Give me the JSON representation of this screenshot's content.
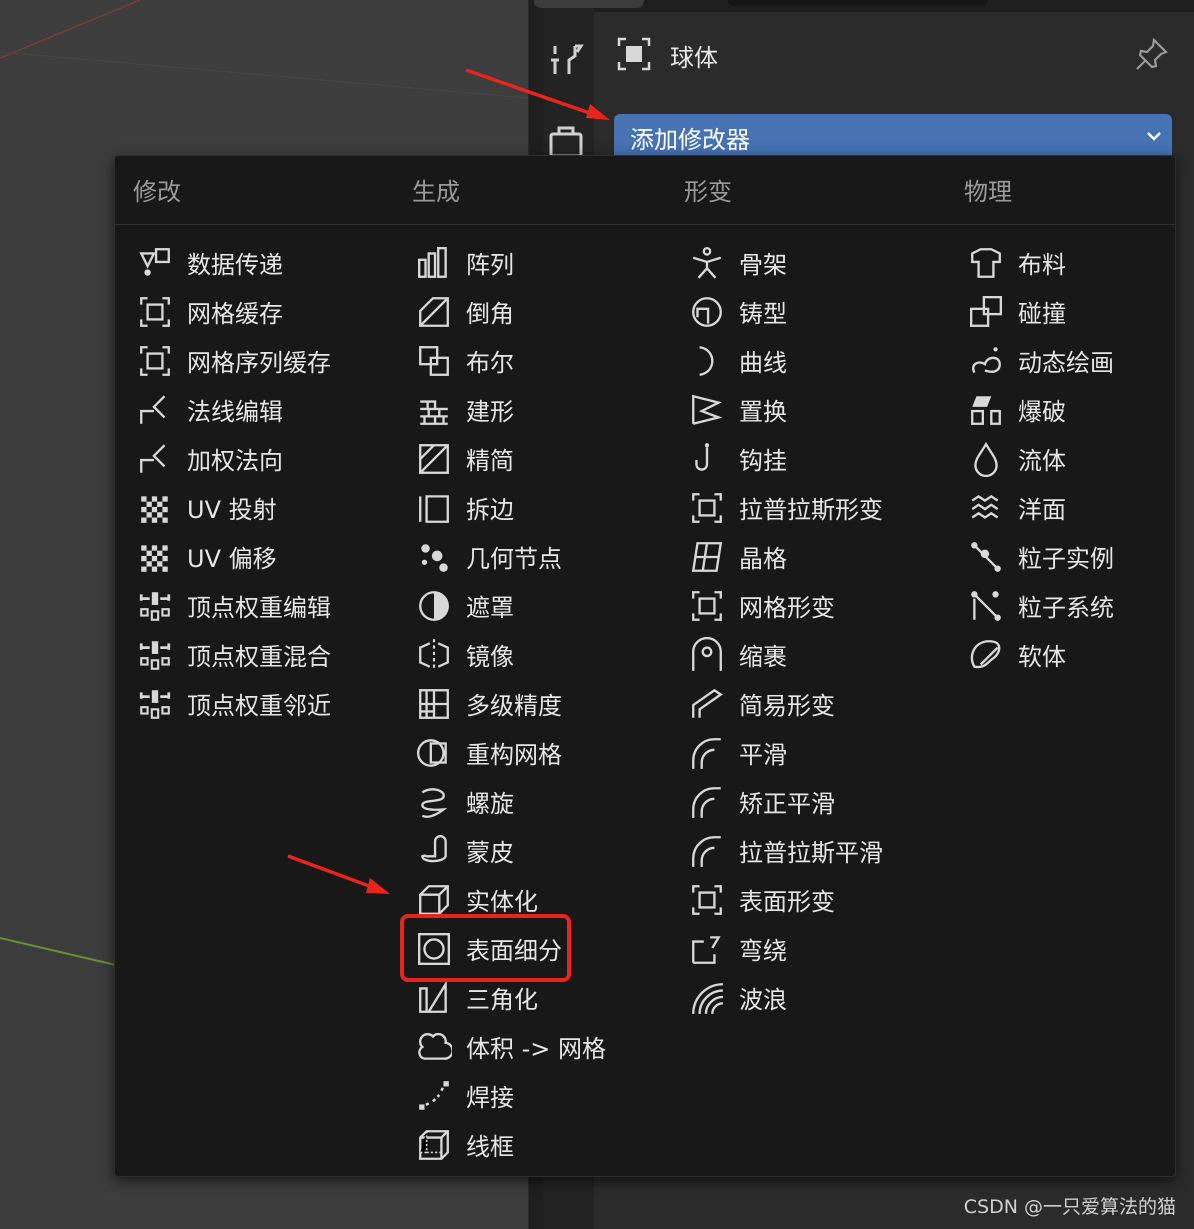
{
  "object": {
    "name": "球体",
    "icon": "mesh-object-icon"
  },
  "add_modifier": {
    "label": "添加修改器",
    "icon": "chevron-down-icon"
  },
  "categories": [
    "修改",
    "生成",
    "形变",
    "物理"
  ],
  "columns": [
    {
      "category": "修改",
      "items": [
        {
          "label": "数据传递",
          "icon": "data-transfer-icon"
        },
        {
          "label": "网格缓存",
          "icon": "mesh-cache-icon"
        },
        {
          "label": "网格序列缓存",
          "icon": "mesh-sequence-cache-icon"
        },
        {
          "label": "法线编辑",
          "icon": "normal-edit-icon"
        },
        {
          "label": "加权法向",
          "icon": "weighted-normal-icon"
        },
        {
          "label": "UV 投射",
          "icon": "uv-project-icon"
        },
        {
          "label": "UV 偏移",
          "icon": "uv-warp-icon"
        },
        {
          "label": "顶点权重编辑",
          "icon": "vertex-weight-edit-icon"
        },
        {
          "label": "顶点权重混合",
          "icon": "vertex-weight-mix-icon"
        },
        {
          "label": "顶点权重邻近",
          "icon": "vertex-weight-proximity-icon"
        }
      ]
    },
    {
      "category": "生成",
      "items": [
        {
          "label": "阵列",
          "icon": "array-icon"
        },
        {
          "label": "倒角",
          "icon": "bevel-icon"
        },
        {
          "label": "布尔",
          "icon": "boolean-icon"
        },
        {
          "label": "建形",
          "icon": "build-icon"
        },
        {
          "label": "精简",
          "icon": "decimate-icon"
        },
        {
          "label": "拆边",
          "icon": "edge-split-icon"
        },
        {
          "label": "几何节点",
          "icon": "geometry-nodes-icon"
        },
        {
          "label": "遮罩",
          "icon": "mask-icon"
        },
        {
          "label": "镜像",
          "icon": "mirror-icon"
        },
        {
          "label": "多级精度",
          "icon": "multires-icon"
        },
        {
          "label": "重构网格",
          "icon": "remesh-icon"
        },
        {
          "label": "螺旋",
          "icon": "screw-icon"
        },
        {
          "label": "蒙皮",
          "icon": "skin-icon"
        },
        {
          "label": "实体化",
          "icon": "solidify-icon"
        },
        {
          "label": "表面细分",
          "icon": "subdivision-surface-icon"
        },
        {
          "label": "三角化",
          "icon": "triangulate-icon"
        },
        {
          "label": "体积 -> 网格",
          "icon": "volume-to-mesh-icon"
        },
        {
          "label": "焊接",
          "icon": "weld-icon"
        },
        {
          "label": "线框",
          "icon": "wireframe-icon"
        }
      ]
    },
    {
      "category": "形变",
      "items": [
        {
          "label": "骨架",
          "icon": "armature-icon"
        },
        {
          "label": "铸型",
          "icon": "cast-icon"
        },
        {
          "label": "曲线",
          "icon": "curve-icon"
        },
        {
          "label": "置换",
          "icon": "displace-icon"
        },
        {
          "label": "钩挂",
          "icon": "hook-icon"
        },
        {
          "label": "拉普拉斯形变",
          "icon": "laplacian-deform-icon"
        },
        {
          "label": "晶格",
          "icon": "lattice-icon"
        },
        {
          "label": "网格形变",
          "icon": "mesh-deform-icon"
        },
        {
          "label": "缩裹",
          "icon": "shrinkwrap-icon"
        },
        {
          "label": "简易形变",
          "icon": "simple-deform-icon"
        },
        {
          "label": "平滑",
          "icon": "smooth-icon"
        },
        {
          "label": "矫正平滑",
          "icon": "corrective-smooth-icon"
        },
        {
          "label": "拉普拉斯平滑",
          "icon": "laplacian-smooth-icon"
        },
        {
          "label": "表面形变",
          "icon": "surface-deform-icon"
        },
        {
          "label": "弯绕",
          "icon": "warp-icon"
        },
        {
          "label": "波浪",
          "icon": "wave-icon"
        }
      ]
    },
    {
      "category": "物理",
      "items": [
        {
          "label": "布料",
          "icon": "cloth-icon"
        },
        {
          "label": "碰撞",
          "icon": "collision-icon"
        },
        {
          "label": "动态绘画",
          "icon": "dynamic-paint-icon"
        },
        {
          "label": "爆破",
          "icon": "explode-icon"
        },
        {
          "label": "流体",
          "icon": "fluid-icon"
        },
        {
          "label": "洋面",
          "icon": "ocean-icon"
        },
        {
          "label": "粒子实例",
          "icon": "particle-instance-icon"
        },
        {
          "label": "粒子系统",
          "icon": "particle-system-icon"
        },
        {
          "label": "软体",
          "icon": "soft-body-icon"
        }
      ]
    }
  ],
  "highlight": "表面细分",
  "colors": {
    "accent": "#4772b3",
    "annotation": "#e8241c",
    "menu_bg": "#181818"
  },
  "watermark": "CSDN @一只爱算法的猫"
}
